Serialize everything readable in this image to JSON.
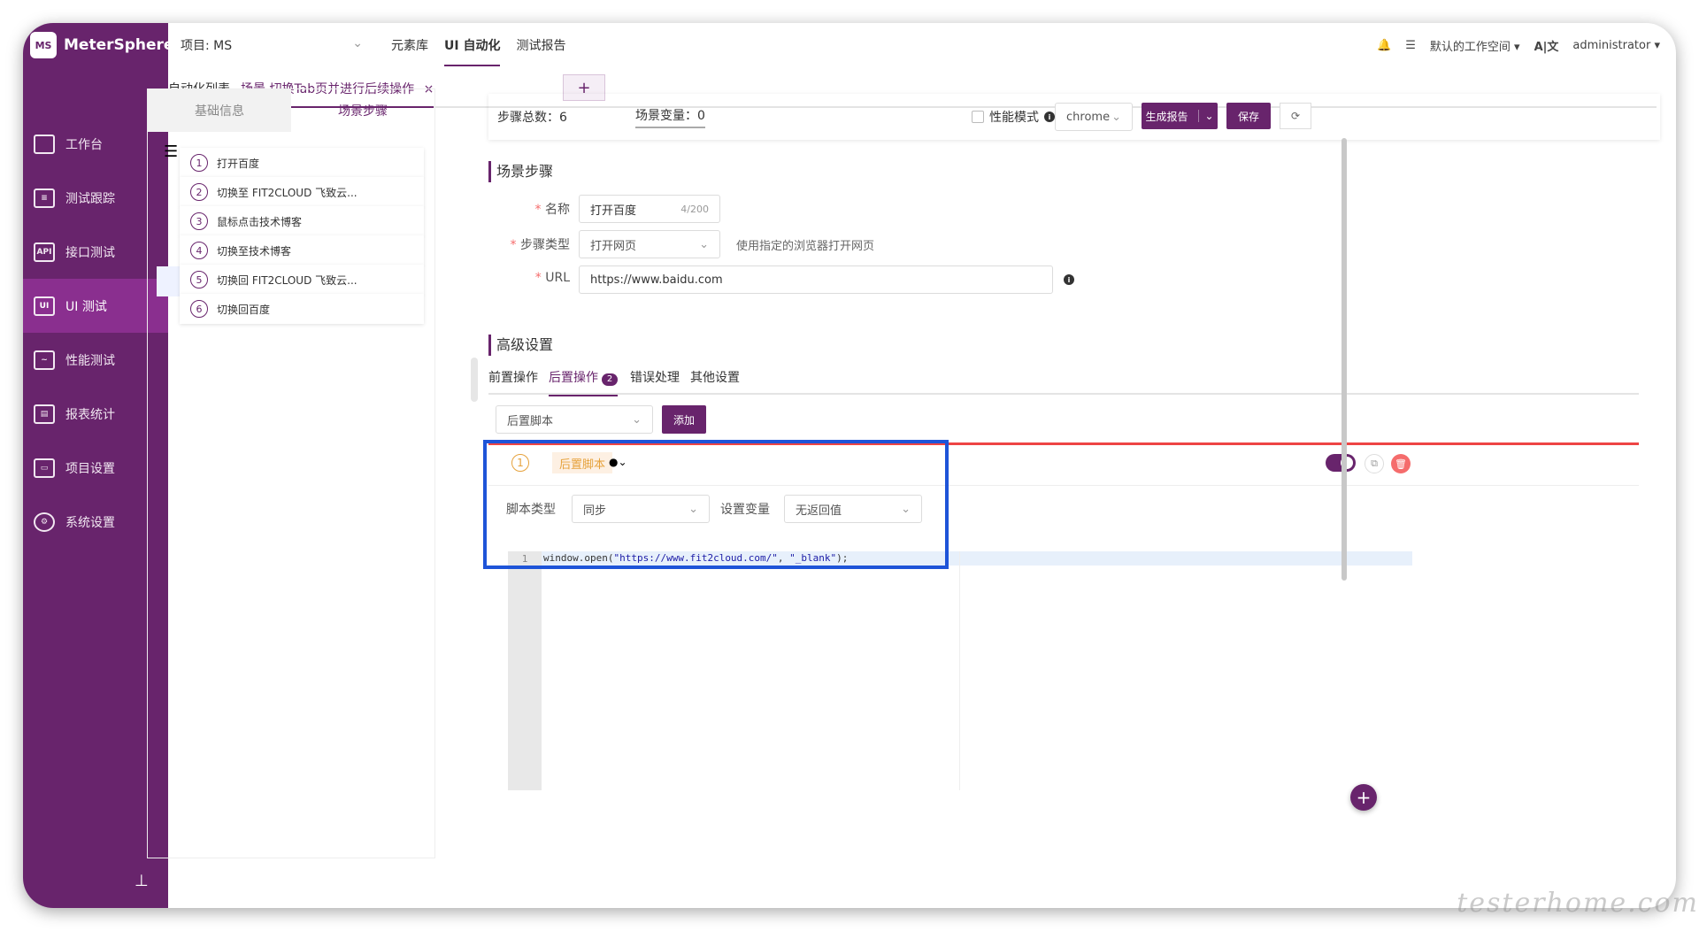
{
  "app": {
    "name": "MeterSphere",
    "logo_text": "MS"
  },
  "nav": {
    "items": [
      {
        "label": "工作台",
        "icon": "monitor-icon"
      },
      {
        "label": "测试跟踪",
        "icon": "clipboard-icon"
      },
      {
        "label": "接口测试",
        "icon": "api-icon"
      },
      {
        "label": "UI 测试",
        "icon": "ui-icon"
      },
      {
        "label": "性能测试",
        "icon": "chart-icon"
      },
      {
        "label": "报表统计",
        "icon": "report-icon"
      },
      {
        "label": "项目设置",
        "icon": "folder-icon"
      },
      {
        "label": "系统设置",
        "icon": "gear-icon"
      }
    ],
    "active_index": 3
  },
  "topbar": {
    "project": "项目: MS",
    "links": [
      "元素库",
      "UI 自动化",
      "测试报告"
    ],
    "workspace": "默认的工作空间",
    "user": "administrator"
  },
  "tabs": {
    "list": "自动化列表",
    "scene": "场景 切换Tab页并进行后续操作",
    "close": "×",
    "add": "+"
  },
  "left_panel": {
    "tab_basic": "基础信息",
    "tab_steps": "场景步骤",
    "steps": [
      {
        "num": "1",
        "label": "打开百度"
      },
      {
        "num": "2",
        "label": "切换至 FIT2CLOUD 飞致云..."
      },
      {
        "num": "3",
        "label": "鼠标点击技术博客"
      },
      {
        "num": "4",
        "label": "切换至技术博客"
      },
      {
        "num": "5",
        "label": "切换回 FIT2CLOUD 飞致云..."
      },
      {
        "num": "6",
        "label": "切换回百度"
      }
    ]
  },
  "summary": {
    "steps_total": "步骤总数：6",
    "scene_vars": "场景变量：0",
    "perf_mode": "性能模式",
    "browser": "chrome",
    "gen_report": "生成报告",
    "save": "保存"
  },
  "step_form": {
    "section_title": "场景步骤",
    "name_label": "名称",
    "name_value": "打开百度",
    "name_count": "4/200",
    "type_label": "步骤类型",
    "type_value": "打开网页",
    "type_hint": "使用指定的浏览器打开网页",
    "url_label": "URL",
    "url_value": "https://www.baidu.com"
  },
  "advanced": {
    "section_title": "高级设置",
    "tabs": [
      "前置操作",
      "后置操作",
      "错误处理",
      "其他设置"
    ],
    "active_tab": 1,
    "badge": "2",
    "script_select": "后置脚本",
    "add_button": "添加"
  },
  "script_card": {
    "num": "1",
    "tag": "后置脚本",
    "script_type_label": "脚本类型",
    "script_type_value": "同步",
    "set_var_label": "设置变量",
    "set_var_value": "无返回值",
    "line_no": "1",
    "code_prefix": "window.open(",
    "code_str1": "\"https://www.fit2cloud.com/\"",
    "code_sep": ", ",
    "code_str2": "\"_blank\"",
    "code_suffix": ");"
  },
  "watermark": "testerhome.com",
  "colors": {
    "brand": "#68246c",
    "highlight": "#1e54d8",
    "danger": "#f56c6c",
    "warning": "#e6a23c"
  }
}
